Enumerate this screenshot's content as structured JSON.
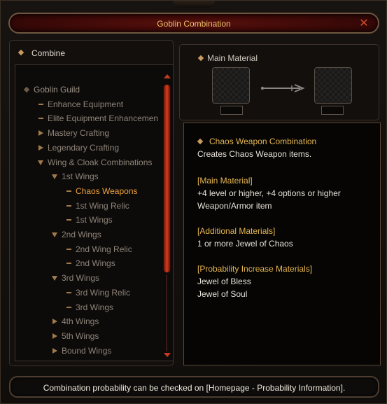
{
  "window": {
    "title": "Goblin Combination",
    "close_icon": "close-icon"
  },
  "left": {
    "header": "Combine",
    "tree": [
      {
        "label": "Goblin Guild",
        "level": 0,
        "marker": "diamond"
      },
      {
        "label": "Enhance Equipment",
        "level": 1,
        "marker": "dash"
      },
      {
        "label": "Elite Equipment Enhancemen",
        "level": 1,
        "marker": "dash"
      },
      {
        "label": "Mastery Crafting",
        "level": 1,
        "marker": "right"
      },
      {
        "label": "Legendary Crafting",
        "level": 1,
        "marker": "right"
      },
      {
        "label": "Wing & Cloak Combinations",
        "level": 1,
        "marker": "down"
      },
      {
        "label": "1st Wings",
        "level": 2,
        "marker": "down"
      },
      {
        "label": "Chaos Weapons",
        "level": 3,
        "marker": "dash",
        "selected": true
      },
      {
        "label": "1st Wing Relic",
        "level": 3,
        "marker": "dash"
      },
      {
        "label": "1st Wings",
        "level": 3,
        "marker": "dash"
      },
      {
        "label": "2nd Wings",
        "level": 2,
        "marker": "down"
      },
      {
        "label": "2nd Wing Relic",
        "level": 3,
        "marker": "dash"
      },
      {
        "label": "2nd Wings",
        "level": 3,
        "marker": "dash"
      },
      {
        "label": "3rd Wings",
        "level": 2,
        "marker": "down"
      },
      {
        "label": "3rd Wing Relic",
        "level": 3,
        "marker": "dash"
      },
      {
        "label": "3rd Wings",
        "level": 3,
        "marker": "dash"
      },
      {
        "label": "4th Wings",
        "level": 2,
        "marker": "right"
      },
      {
        "label": "5th Wings",
        "level": 2,
        "marker": "right"
      },
      {
        "label": "Bound Wings",
        "level": 2,
        "marker": "right"
      }
    ]
  },
  "right": {
    "main_material_label": "Main Material",
    "info": {
      "title": "Chaos Weapon Combination",
      "description": "Creates Chaos Weapon items.",
      "main_material_head": "[Main Material]",
      "main_material_line1": "+4 level or higher, +4 options or higher",
      "main_material_line2": "Weapon/Armor item",
      "additional_head": "[Additional Materials]",
      "additional_line1": "1 or more Jewel of Chaos",
      "probability_head": "[Probability Increase Materials]",
      "probability_line1": "Jewel of Bless",
      "probability_line2": "Jewel of Soul"
    }
  },
  "footer": {
    "text": "Combination probability can be checked on [Homepage - Probability Information]."
  },
  "colors": {
    "accent": "#e4b54f",
    "selected": "#f0a13a",
    "scroll": "#d63d1d",
    "title_bg": "#3b0907"
  }
}
